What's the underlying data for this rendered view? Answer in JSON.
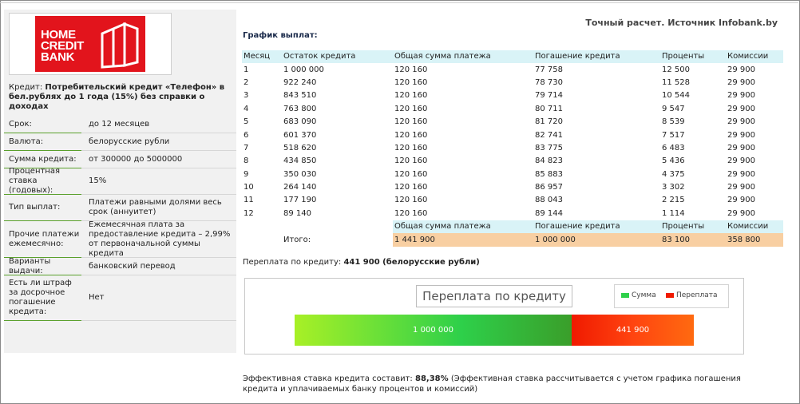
{
  "source": "Точный расчет. Источник Infobank.by",
  "logo": {
    "line1": "HOME",
    "line2": "CREDIT",
    "line3": "BANK",
    "brand_color": "#e2141c"
  },
  "credit": {
    "label": "Кредит:",
    "name": "Потребительский кредит «Телефон» в бел.рублях до 1 года (15%) без справки о доходах"
  },
  "params": [
    {
      "key": "Срок:",
      "value": "до 12 месяцев"
    },
    {
      "key": "Валюта:",
      "value": "белорусские рубли"
    },
    {
      "key": "Сумма кредита:",
      "value": "от 300000 до 5000000"
    },
    {
      "key": "Процентная ставка (годовых):",
      "value": "15%"
    },
    {
      "key": "Тип выплат:",
      "value": "Платежи равными долями весь срок (аннуитет)"
    },
    {
      "key": "Прочие платежи ежемесячно:",
      "value": "Ежемесячная плата за предоставление кредита – 2,99% от первоначальной суммы кредита"
    },
    {
      "key": "Варианты выдачи:",
      "value": "банковский перевод"
    },
    {
      "key": "Есть ли штраф за досрочное погашение кредита:",
      "value": "Нет"
    }
  ],
  "schedule": {
    "title": "График выплат:",
    "headers": [
      "Месяц",
      "Остаток кредита",
      "Общая сумма платежа",
      "Погашение кредита",
      "Проценты",
      "Комиссии"
    ],
    "rows": [
      [
        "1",
        "1 000 000",
        "120 160",
        "77 758",
        "12 500",
        "29 900"
      ],
      [
        "2",
        "922 240",
        "120 160",
        "78 730",
        "11 528",
        "29 900"
      ],
      [
        "3",
        "843 510",
        "120 160",
        "79 714",
        "10 544",
        "29 900"
      ],
      [
        "4",
        "763 800",
        "120 160",
        "80 711",
        "9 547",
        "29 900"
      ],
      [
        "5",
        "683 090",
        "120 160",
        "81 720",
        "8 539",
        "29 900"
      ],
      [
        "6",
        "601 370",
        "120 160",
        "82 741",
        "7 517",
        "29 900"
      ],
      [
        "7",
        "518 620",
        "120 160",
        "83 775",
        "6 483",
        "29 900"
      ],
      [
        "8",
        "434 850",
        "120 160",
        "84 823",
        "5 436",
        "29 900"
      ],
      [
        "9",
        "350 030",
        "120 160",
        "85 883",
        "4 375",
        "29 900"
      ],
      [
        "10",
        "264 140",
        "120 160",
        "86 957",
        "3 302",
        "29 900"
      ],
      [
        "11",
        "177 190",
        "120 160",
        "88 043",
        "2 215",
        "29 900"
      ],
      [
        "12",
        "89 140",
        "120 160",
        "89 144",
        "1 114",
        "29 900"
      ]
    ],
    "totals_headers": [
      "Общая сумма платежа",
      "Погашение кредита",
      "Проценты",
      "Комиссии"
    ],
    "totals_label": "Итого:",
    "totals": [
      "1 441 900",
      "1 000 000",
      "83 100",
      "358 800"
    ]
  },
  "overpay": {
    "label": "Переплата по кредиту:",
    "value": "441 900 (белорусские рубли)"
  },
  "chart_data": {
    "type": "bar",
    "title": "Переплата по кредиту",
    "stacked": true,
    "orientation": "horizontal",
    "series": [
      {
        "name": "Сумма",
        "value": 1000000,
        "label": "1 000 000",
        "color": "#2ed04a"
      },
      {
        "name": "Переплата",
        "value": 441900,
        "label": "441 900",
        "color": "#f01a00"
      }
    ],
    "legend_position": "top-right"
  },
  "effective": {
    "label": "Эффективная ставка кредита составит:",
    "value": "88,38%",
    "note": "(Эффективная ставка рассчитывается с учетом графика погашения кредита и уплачиваемых банку процентов и комиссий)"
  }
}
